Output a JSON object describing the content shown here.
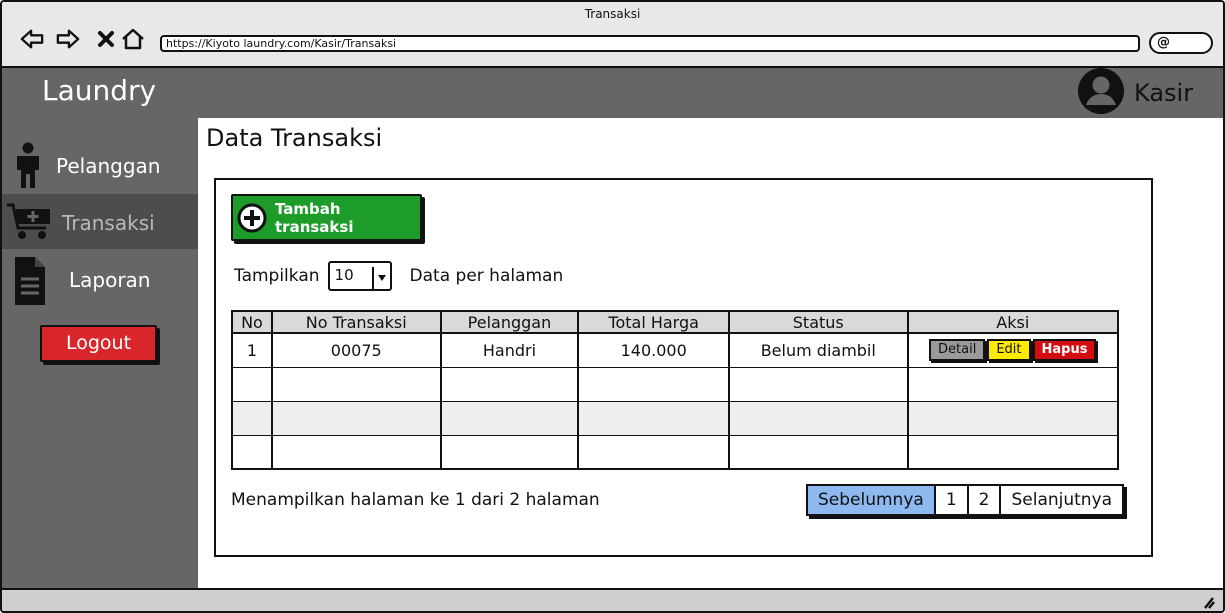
{
  "browser": {
    "window_title": "Transaksi",
    "url": "https://Kiyoto laundry.com/Kasir/Transaksi"
  },
  "header": {
    "brand": "Laundry",
    "user_label": "Kasir"
  },
  "sidebar": {
    "items": [
      {
        "label": "Pelanggan",
        "icon": "person-icon"
      },
      {
        "label": "Transaksi",
        "icon": "cart-icon",
        "active": true
      },
      {
        "label": "Laporan",
        "icon": "document-icon"
      }
    ],
    "logout_label": "Logout"
  },
  "main": {
    "title": "Data Transaksi",
    "add_button_label": "Tambah transaksi",
    "show_prefix": "Tampilkan",
    "per_page_value": "10",
    "show_suffix": "Data per halaman",
    "table": {
      "columns": [
        "No",
        "No Transaksi",
        "Pelanggan",
        "Total Harga",
        "Status",
        "Aksi"
      ],
      "rows": [
        {
          "no": "1",
          "no_transaksi": "00075",
          "pelanggan": "Handri",
          "total_harga": "140.000",
          "status": "Belum diambil"
        }
      ],
      "actions": {
        "detail": "Detail",
        "edit": "Edit",
        "hapus": "Hapus"
      }
    },
    "page_info": "Menampilkan halaman ke 1 dari 2 halaman",
    "pagination": {
      "prev": "Sebelumnya",
      "pages": [
        "1",
        "2"
      ],
      "next": "Selanjutnya"
    }
  },
  "colors": {
    "sidebar_bg": "#666666",
    "add_button": "#1e9c2a",
    "logout": "#d9262b",
    "hapus": "#d40d12",
    "edit": "#ffea00",
    "pager_active": "#8eb8f0"
  }
}
